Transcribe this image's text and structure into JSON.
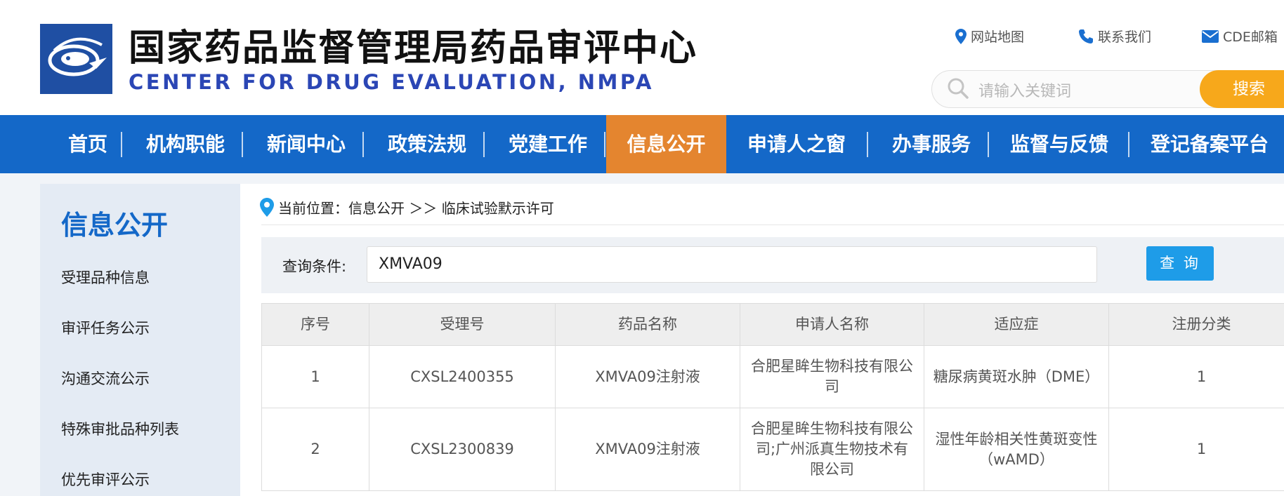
{
  "header": {
    "title_cn": "国家药品监督管理局药品审评中心",
    "title_en": "CENTER FOR DRUG EVALUATION, NMPA",
    "links": {
      "sitemap": "网站地图",
      "contact": "联系我们",
      "mail": "CDE邮箱"
    },
    "search": {
      "placeholder": "请输入关键词",
      "button": "搜索"
    }
  },
  "nav": {
    "items": [
      "首页",
      "机构职能",
      "新闻中心",
      "政策法规",
      "党建工作",
      "信息公开",
      "申请人之窗",
      "办事服务",
      "监督与反馈",
      "登记备案平台"
    ],
    "active": "信息公开"
  },
  "sidebar": {
    "title": "信息公开",
    "items": [
      "受理品种信息",
      "审评任务公示",
      "沟通交流公示",
      "特殊审批品种列表",
      "优先审评公示"
    ]
  },
  "breadcrumb": "当前位置：信息公开 ＞＞ 临床试验默示许可",
  "query": {
    "label": "查询条件:",
    "value": "XMVA09",
    "button": "查 询"
  },
  "table": {
    "headers": [
      "序号",
      "受理号",
      "药品名称",
      "申请人名称",
      "适应症",
      "注册分类"
    ],
    "rows": [
      [
        "1",
        "CXSL2400355",
        "XMVA09注射液",
        "合肥星眸生物科技有限公司",
        "糖尿病黄斑水肿（DME）",
        "1"
      ],
      [
        "2",
        "CXSL2300839",
        "XMVA09注射液",
        "合肥星眸生物科技有限公司;广州派真生物技术有限公司",
        "湿性年龄相关性黄斑变性（wAMD）",
        "1"
      ]
    ]
  },
  "colors": {
    "nav_bg": "#1468c8",
    "nav_active": "#e4852f",
    "search_button": "#f7a81b",
    "query_button": "#1e9ce8",
    "title_en": "#2b46b5"
  }
}
